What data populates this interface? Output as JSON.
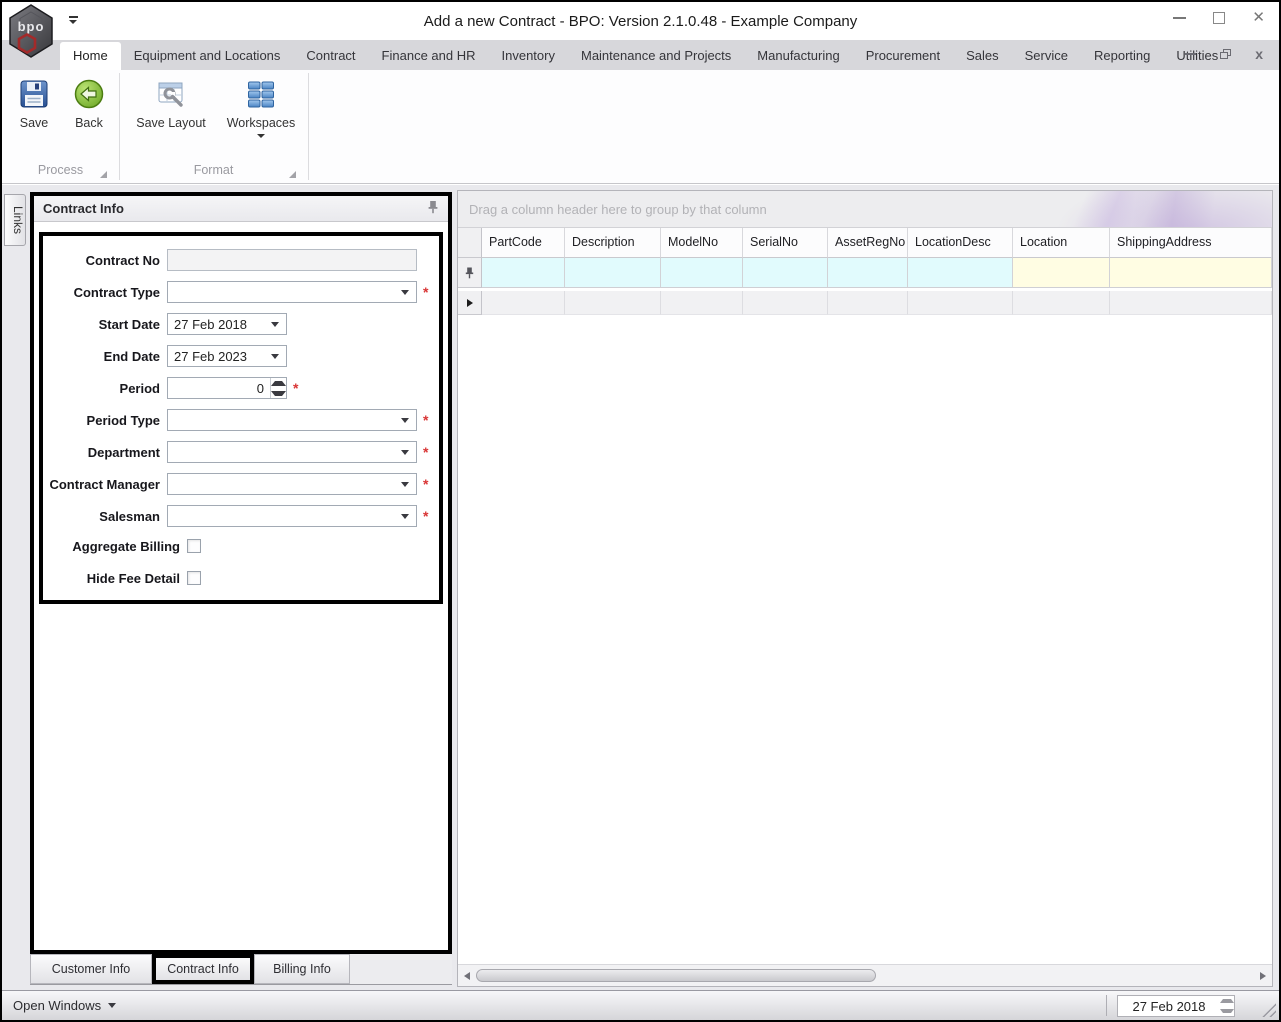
{
  "window": {
    "title": "Add a new Contract - BPO: Version 2.1.0.48 - Example Company",
    "logo_text": "bpo"
  },
  "ribbon": {
    "tabs": [
      "Home",
      "Equipment and Locations",
      "Contract",
      "Finance and HR",
      "Inventory",
      "Maintenance and Projects",
      "Manufacturing",
      "Procurement",
      "Sales",
      "Service",
      "Reporting",
      "Utilities"
    ],
    "active_tab": "Home",
    "buttons": {
      "save": "Save",
      "back": "Back",
      "save_layout": "Save Layout",
      "workspaces": "Workspaces"
    },
    "groups": {
      "process": "Process",
      "format": "Format"
    }
  },
  "links_tab_label": "Links",
  "panel": {
    "title": "Contract Info",
    "required_marker": "*",
    "fields": {
      "contract_no": {
        "label": "Contract No",
        "value": ""
      },
      "contract_type": {
        "label": "Contract Type",
        "value": ""
      },
      "start_date": {
        "label": "Start Date",
        "value": "27 Feb 2018"
      },
      "end_date": {
        "label": "End Date",
        "value": "27 Feb 2023"
      },
      "period": {
        "label": "Period",
        "value": "0"
      },
      "period_type": {
        "label": "Period Type",
        "value": ""
      },
      "department": {
        "label": "Department",
        "value": ""
      },
      "contract_manager": {
        "label": "Contract Manager",
        "value": ""
      },
      "salesman": {
        "label": "Salesman",
        "value": ""
      },
      "aggregate_billing": {
        "label": "Aggregate Billing",
        "checked": false
      },
      "hide_fee_detail": {
        "label": "Hide Fee Detail",
        "checked": false
      }
    },
    "tabs": [
      "Customer Info",
      "Contract Info",
      "Billing Info"
    ],
    "selected_tab": "Contract Info"
  },
  "grid": {
    "group_hint": "Drag a column header here to group by that column",
    "columns": [
      "PartCode",
      "Description",
      "ModelNo",
      "SerialNo",
      "AssetRegNo",
      "LocationDesc",
      "Location",
      "ShippingAddress"
    ]
  },
  "statusbar": {
    "open_windows_label": "Open Windows",
    "date_value": "27 Feb 2018"
  },
  "colors": {
    "filter_cyan": "#e1fbfd",
    "filter_yellow": "#fffde3",
    "required_red": "#d93535"
  }
}
